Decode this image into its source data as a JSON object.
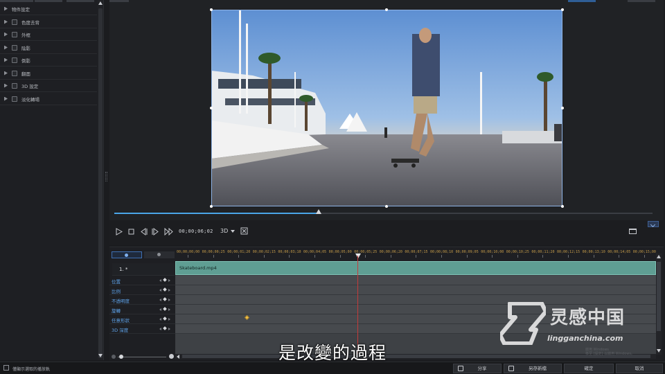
{
  "left_panel": {
    "items": [
      {
        "label": "物件設定",
        "checkbox": false
      },
      {
        "label": "色度去背",
        "checkbox": true
      },
      {
        "label": "外框",
        "checkbox": true
      },
      {
        "label": "陰影",
        "checkbox": true
      },
      {
        "label": "倒影",
        "checkbox": true
      },
      {
        "label": "翻面",
        "checkbox": true
      },
      {
        "label": "3D 設定",
        "checkbox": true
      },
      {
        "label": "淡化轉場",
        "checkbox": true
      }
    ]
  },
  "preview": {
    "progress": 0.38
  },
  "controls": {
    "timecode": "00;00;06;02",
    "mode_3d": "3D",
    "icons": [
      "play-icon",
      "stop-icon",
      "previous-frame-icon",
      "next-frame-icon",
      "fast-forward-icon",
      "fullscreen-icon",
      "aspect-ratio-icon"
    ]
  },
  "timeline": {
    "ruler_ticks": [
      "00;00;00;00",
      "00;00;00;25",
      "00;00;01;20",
      "00;00;02;15",
      "00;00;03;10",
      "00;00;04;05",
      "00;00;05;00",
      "00;00;05;25",
      "00;00;06;20",
      "00;00;07;15",
      "00;00;08;10",
      "00;00;09;05",
      "00;00;10;00",
      "00;00;10;25",
      "00;00;11;20",
      "00;00;12;15",
      "00;00;13;10",
      "00;00;14;05",
      "00;00;15;00"
    ],
    "track_title": "1. *",
    "clip_name": "Skateboard.mp4",
    "params": [
      "位置",
      "比例",
      "不透明度",
      "旋轉",
      "任意形狀",
      "3D 深度"
    ],
    "keyframe_time": "00;00;01;20"
  },
  "subtitle": "是改變的過程",
  "watermark": {
    "cn": "灵感中国",
    "en": "lingganchina.com"
  },
  "windows_activation": {
    "line1": "啟用 Windows",
    "line2": "移至 [設定] 以啟用 Windows。"
  },
  "bottom_bar": {
    "checkbox_label": "僅顯示選取的播放軌",
    "share": "分享",
    "save_as": "另存新檔",
    "ok": "確定",
    "cancel": "取消"
  },
  "colors": {
    "accent": "#4aa6e8",
    "clip": "#5f9e93",
    "param_label": "#5fa3ea",
    "keyframe": "#f1c24a",
    "playhead": "#c43b3b",
    "ruler_text": "#c79d4a"
  }
}
